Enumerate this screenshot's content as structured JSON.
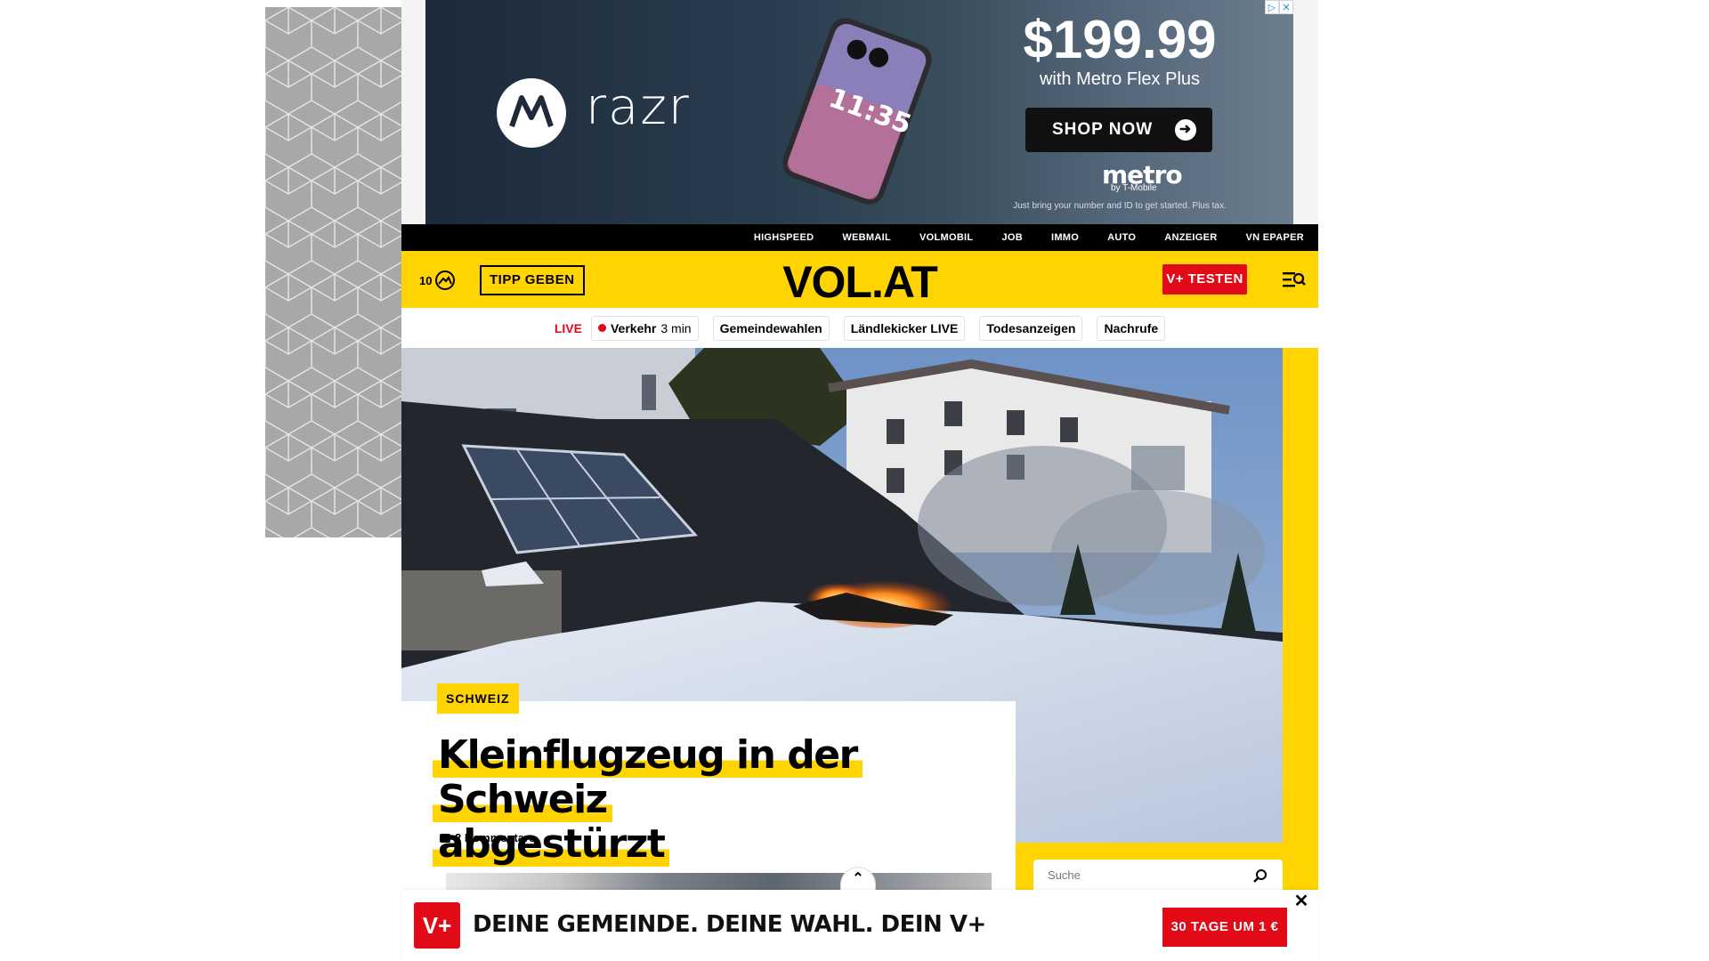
{
  "ad": {
    "brand": "razr",
    "price": "$199.99",
    "subline": "with Metro Flex Plus",
    "cta_label": "SHOP NOW",
    "sponsor": "metro",
    "sponsor_by": "by T-Mobile",
    "fine_print": "Just bring your number and ID to get started. Plus tax.",
    "phone_time": "11:35"
  },
  "topnav": {
    "items": [
      "HIGHSPEED",
      "WEBMAIL",
      "VOLMOBIL",
      "JOB",
      "IMMO",
      "AUTO",
      "ANZEIGER",
      "VN EPAPER"
    ]
  },
  "header": {
    "weather_temp": "10",
    "tipp_label": "TIPP GEBEN",
    "logo": "VOL.AT",
    "vplus_label": "V+ TESTEN"
  },
  "quicklinks": {
    "live_label": "LIVE",
    "verkehr_label": "Verkehr",
    "verkehr_meta": "3 min",
    "items": [
      "Gemeindewahlen",
      "Ländlekicker LIVE",
      "Todesanzeigen",
      "Nachrufe"
    ]
  },
  "article": {
    "category": "SCHWEIZ",
    "headline_line1": "Kleinflugzeug in der Schweiz",
    "headline_line2": "abgestürzt",
    "comments": "2 Kommentare"
  },
  "search": {
    "placeholder": "Suche"
  },
  "sticky": {
    "logo": "V+",
    "text": "DEINE GEMEINDE. DEINE WAHL. DEIN V+",
    "cta_label": "30 TAGE UM 1 €",
    "close": "✕"
  },
  "colors": {
    "brand_yellow": "#ffd400",
    "brand_red": "#e20a16",
    "nav_black": "#000000"
  }
}
